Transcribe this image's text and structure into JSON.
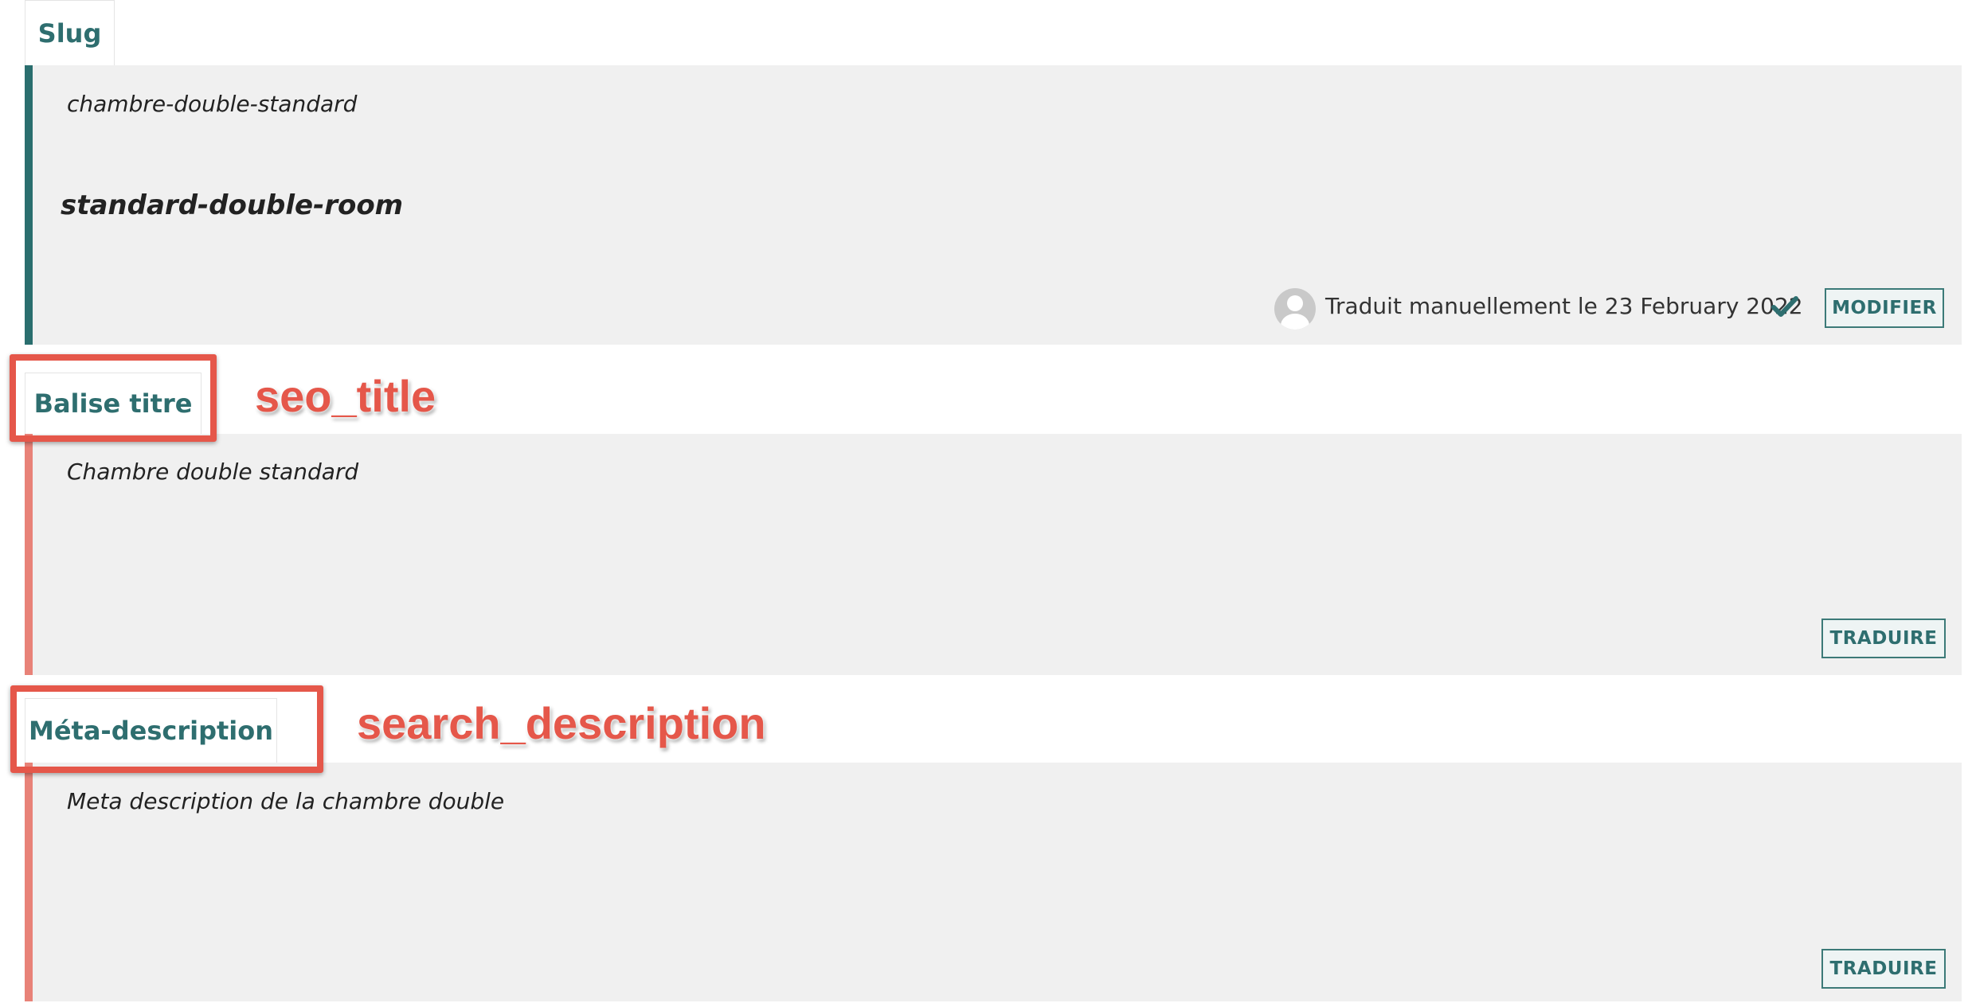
{
  "fields": [
    {
      "tab_label": "Slug",
      "source_text": "chambre-double-standard",
      "translated_text": "standard-double-room",
      "status_text": "Traduit manuellement le 23 February 2022",
      "button_label": "MODIFIER"
    },
    {
      "tab_label": "Balise titre",
      "source_text": "Chambre double standard",
      "button_label": "TRADUIRE",
      "annotation": "seo_title"
    },
    {
      "tab_label": "Méta-description",
      "source_text": "Meta description de la chambre double",
      "button_label": "TRADUIRE",
      "annotation": "search_description"
    }
  ],
  "icons": {
    "avatar": "user-avatar-icon",
    "check": "checkmark-icon"
  },
  "colors": {
    "accent": "#2e6e6f",
    "translated_bar": "#2a6e6e",
    "untranslated_bar": "#e88278",
    "annotation": "#e5574a",
    "panel_bg": "#f0f0f0"
  }
}
